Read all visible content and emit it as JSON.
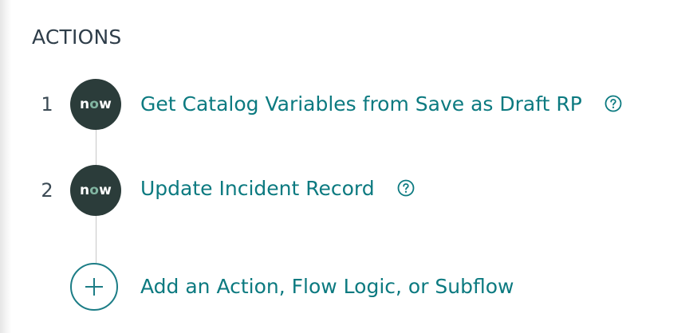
{
  "section": {
    "title": "ACTIONS"
  },
  "logo_text": {
    "pre": "n",
    "o": "o",
    "post": "w"
  },
  "actions": [
    {
      "number": "1",
      "label": "Get Catalog Variables from Save as Draft RP",
      "icon": "help-circle-icon"
    },
    {
      "number": "2",
      "label": "Update Incident Record",
      "icon": "help-circle-icon"
    }
  ],
  "add": {
    "label": "Add an Action, Flow Logic, or Subflow",
    "icon": "plus-icon"
  },
  "colors": {
    "link": "#0c7a80",
    "badge_bg": "#2b3c3a",
    "badge_o": "#81b5a1",
    "title": "#2e3d49"
  }
}
